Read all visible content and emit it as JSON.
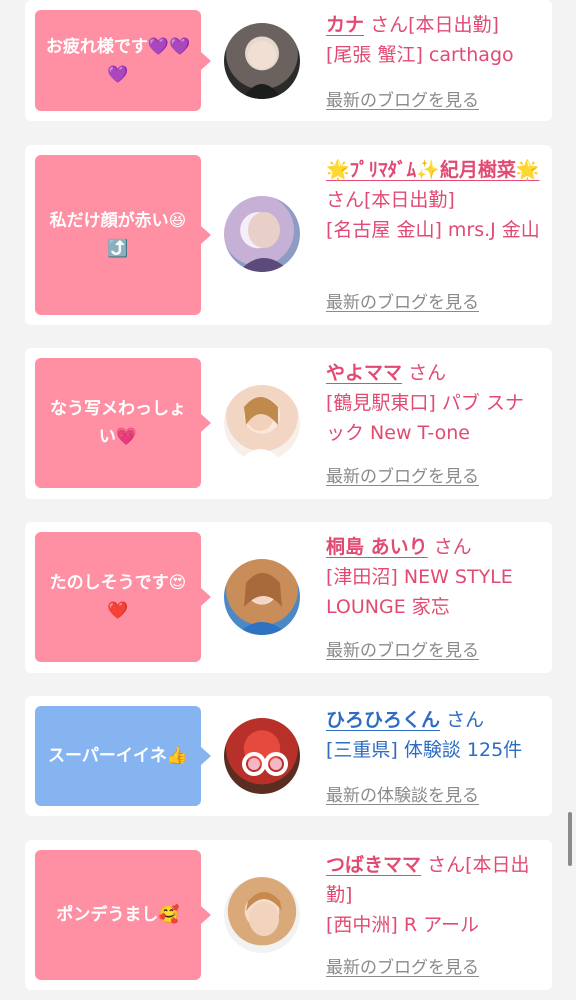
{
  "cards": [
    {
      "message": "お疲れ様です💜💜💜",
      "name": "カナ",
      "suffix": "さん[本日出勤]",
      "location": "[尾張 蟹江] carthago",
      "link": "最新のブログを見る"
    },
    {
      "message": "私だけ顔が赤い😆⤴️",
      "name": "🌟ﾌﾟﾘﾏﾀﾞﾑ✨紀月樹菜🌟",
      "suffix": "さん[本日出勤]",
      "location": "[名古屋 金山] mrs.J 金山",
      "link": "最新のブログを見る"
    },
    {
      "message": "なう写メわっしょい💗",
      "name": "やよママ",
      "suffix": "さん",
      "location": "[鶴見駅東口] パブ スナック New T-one",
      "link": "最新のブログを見る"
    },
    {
      "message": "たのしそうです😍❤️",
      "name": "桐島 あいり",
      "suffix": "さん",
      "location": "[津田沼] NEW STYLE LOUNGE 家忘",
      "link": "最新のブログを見る"
    },
    {
      "message": "スーパーイイネ👍",
      "name": "ひろひろくん",
      "suffix": "さん",
      "location": "[三重県] 体験談 125件",
      "link": "最新の体験談を見る"
    },
    {
      "message": "ポンデうまし🥰",
      "name": "つばきママ",
      "suffix": "さん[本日出勤]",
      "location": "[西中洲] R アール",
      "link": "最新のブログを見る"
    }
  ]
}
